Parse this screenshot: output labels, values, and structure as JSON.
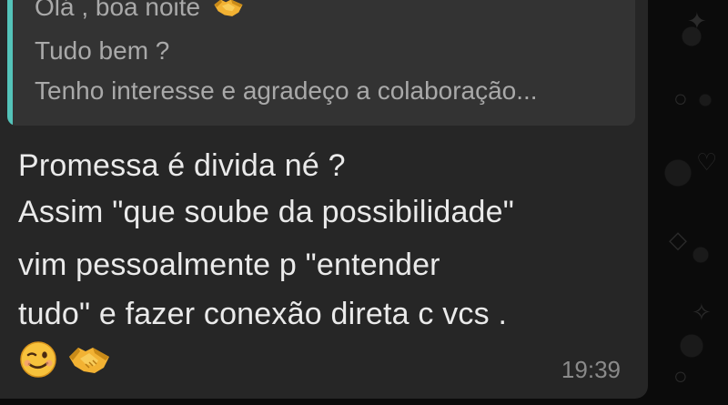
{
  "quoted_message": {
    "line1": "Olá , boa noite",
    "line2": "Tudo bem ?",
    "line3": "Tenho interesse e agradeço a colaboração...",
    "accent_color": "#54c3b9",
    "line1_emoji": "handshake-emoji"
  },
  "message": {
    "line1": "Promessa é divida né ?",
    "line2": "Assim \"que soube da possibilidade\"",
    "line3": "vim pessoalmente p \"entender",
    "line4": "tudo\"  e fazer conexão direta c vcs .",
    "emojis": [
      "winking-face-emoji",
      "handshake-emoji"
    ],
    "time": "19:39"
  },
  "colors": {
    "bubble": "#262626",
    "quote_bg": "#333333",
    "wallpaper": "#0b0b0b"
  }
}
